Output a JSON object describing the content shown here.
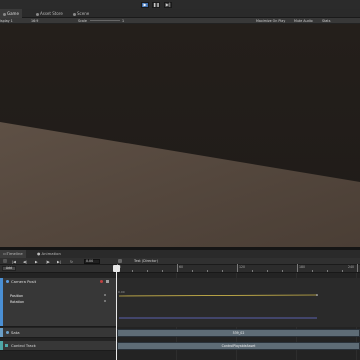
{
  "toolbar": {
    "play_icon": "play-icon",
    "pause_icon": "pause-icon",
    "step_icon": "step-icon",
    "accent": "#3f6fae"
  },
  "tabs": [
    {
      "label": "Game",
      "icon": "game-controller-icon"
    },
    {
      "label": "Asset Store",
      "icon": "store-icon"
    },
    {
      "label": "Scene",
      "icon": "scene-icon"
    }
  ],
  "game_bar": {
    "display": "isplay 1",
    "aspect": "16:9",
    "scale_label": "Scale",
    "scale_value": "1",
    "maximize": "Maximize On Play",
    "mute": "Mute Audio",
    "stats": "Stats"
  },
  "timeline_tabs": [
    {
      "label": "Timeline",
      "icon": "timeline-icon"
    },
    {
      "label": "Animation",
      "icon": "animation-icon"
    }
  ],
  "timeline_toolbar": {
    "frame_value": "0.00",
    "sequence_name": "Test (Director)"
  },
  "add_button": "Add",
  "ruler": {
    "labels": [
      "0",
      "60",
      "120",
      "180",
      "240"
    ]
  },
  "tracks": {
    "camera": {
      "name": "Camera Posit",
      "position": "Position",
      "rotation": "Rotation",
      "value_label": "0.00"
    },
    "audio": {
      "name": "Sata",
      "clip": "539_02"
    },
    "control": {
      "name": "Control Track",
      "clip": "ControlPlayableAsset"
    }
  },
  "colors": {
    "game_sky": "#231f1b",
    "game_ground": "#5a4d42",
    "position_curve": "#c9b24a",
    "rotation_curve": "#6a73d8",
    "audio_bar": "#6a9ec7"
  }
}
